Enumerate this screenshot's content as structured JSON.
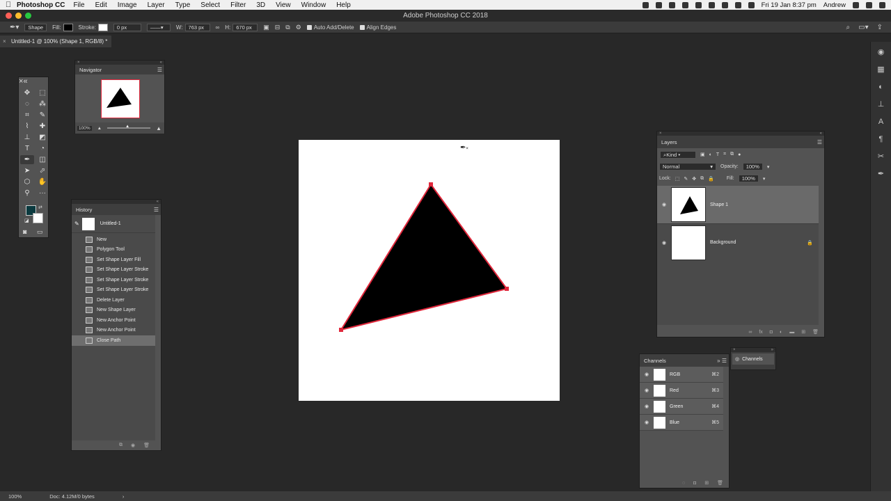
{
  "menubar": {
    "app_name": "Photoshop CC",
    "items": [
      "File",
      "Edit",
      "Image",
      "Layer",
      "Type",
      "Select",
      "Filter",
      "3D",
      "View",
      "Window",
      "Help"
    ],
    "datetime": "Fri 19 Jan  8:37 pm",
    "user": "Andrew"
  },
  "window": {
    "title": "Adobe Photoshop CC 2018"
  },
  "options": {
    "mode": "Shape",
    "fill_label": "Fill:",
    "stroke_label": "Stroke:",
    "stroke_width": "0 px",
    "w_label": "W:",
    "w_value": "763 px",
    "h_label": "H:",
    "h_value": "670 px",
    "auto_add_delete": "Auto Add/Delete",
    "align_edges": "Align Edges"
  },
  "document_tab": {
    "title": "Untitled-1 @ 100% (Shape 1, RGB/8) *"
  },
  "navigator": {
    "title": "Navigator",
    "zoom": "100%"
  },
  "history": {
    "title": "History",
    "snapshot": "Untitled-1",
    "items": [
      "New",
      "Polygon Tool",
      "Set Shape Layer Fill",
      "Set Shape Layer Stroke",
      "Set Shape Layer Stroke",
      "Set Shape Layer Stroke",
      "Delete Layer",
      "New Shape Layer",
      "New Anchor Point",
      "New Anchor Point",
      "Close Path"
    ],
    "selected_index": 10
  },
  "layers": {
    "title": "Layers",
    "filter": "Kind",
    "blend_mode": "Normal",
    "opacity_label": "Opacity:",
    "opacity": "100%",
    "lock_label": "Lock:",
    "fill_label": "Fill:",
    "fill": "100%",
    "items": [
      {
        "name": "Shape 1"
      },
      {
        "name": "Background"
      }
    ]
  },
  "channels": {
    "title": "Channels",
    "collapsed_label": "Channels",
    "items": [
      {
        "name": "RGB",
        "shortcut": "⌘2"
      },
      {
        "name": "Red",
        "shortcut": "⌘3"
      },
      {
        "name": "Green",
        "shortcut": "⌘4"
      },
      {
        "name": "Blue",
        "shortcut": "⌘5"
      }
    ]
  },
  "status": {
    "zoom": "100%",
    "doc_info": "Doc: 4.12M/0 bytes"
  },
  "colors": {
    "path_stroke": "#e0283c",
    "foreground": "#0b3a3f",
    "background": "#ffffff"
  }
}
